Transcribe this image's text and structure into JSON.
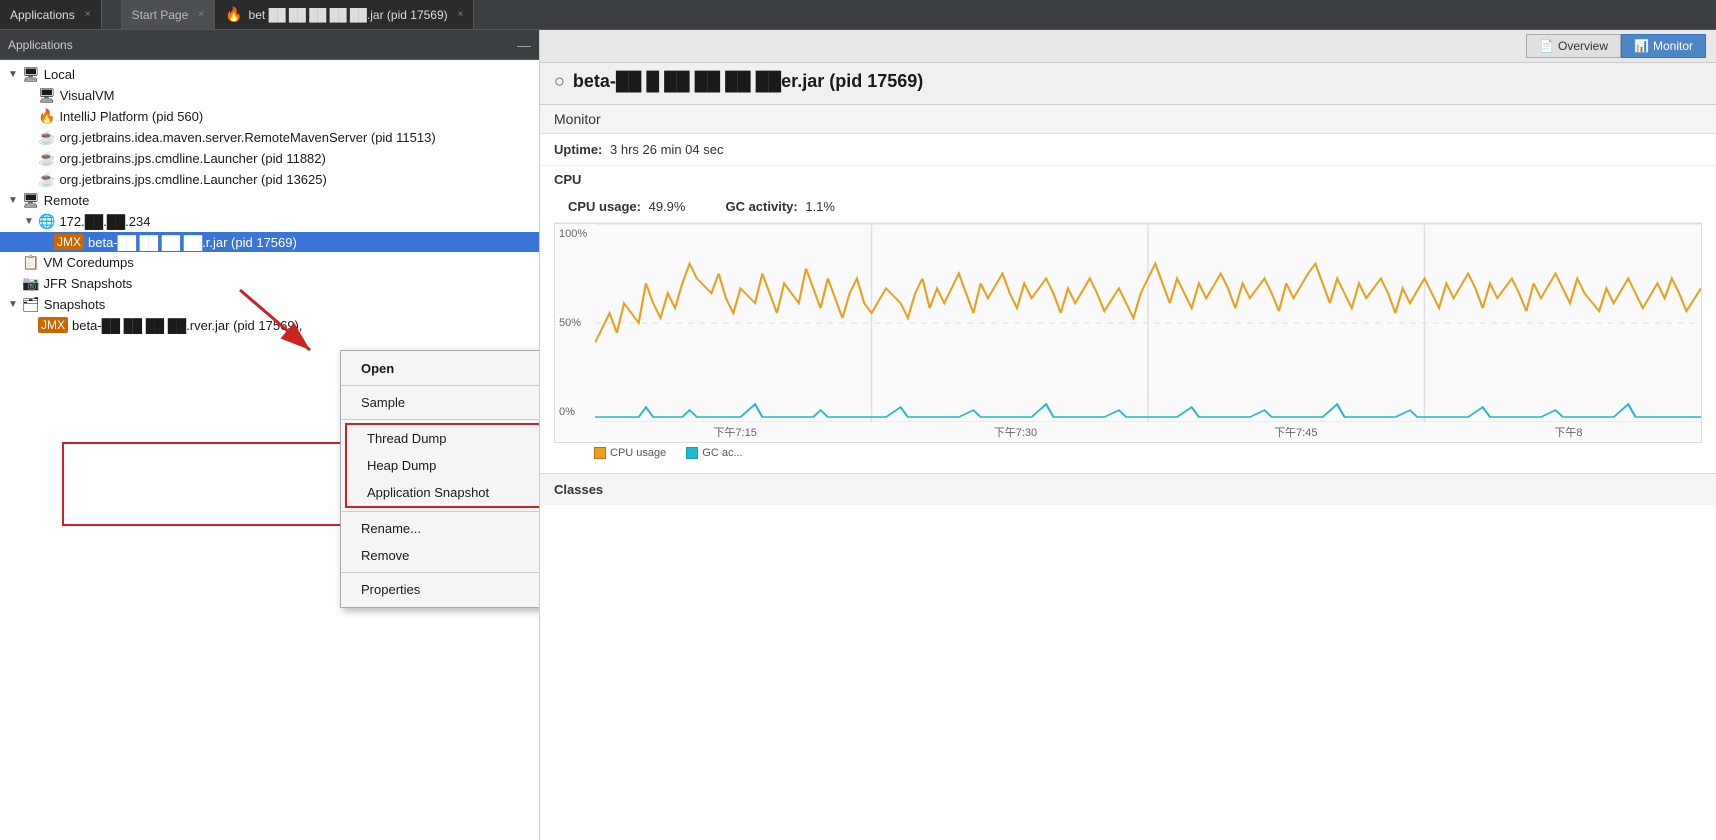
{
  "tabs": {
    "left": {
      "label": "Applications",
      "close": "×"
    },
    "right": [
      {
        "label": "Start Page",
        "close": "×",
        "active": false
      },
      {
        "label": "bet ██ ██ ██ ██ ██.jar (pid 17569)",
        "close": "×",
        "active": true
      }
    ]
  },
  "left_panel": {
    "title": "Applications",
    "minimize": "—",
    "tree": [
      {
        "level": 0,
        "arrow": "",
        "icon": "🖥",
        "label": "Local",
        "type": "folder-open"
      },
      {
        "level": 1,
        "arrow": "",
        "icon": "🖥",
        "label": "VisualVM",
        "type": "item"
      },
      {
        "level": 1,
        "arrow": "",
        "icon": "🔥",
        "label": "IntelliJ Platform (pid 560)",
        "type": "item"
      },
      {
        "level": 1,
        "arrow": "",
        "icon": "☕",
        "label": "org.jetbrains.idea.maven.server.RemoteMavenServer (pid 11513)",
        "type": "item"
      },
      {
        "level": 1,
        "arrow": "",
        "icon": "☕",
        "label": "org.jetbrains.jps.cmdline.Launcher (pid 11882)",
        "type": "item"
      },
      {
        "level": 1,
        "arrow": "",
        "icon": "☕",
        "label": "org.jetbrains.jps.cmdline.Launcher (pid 13625)",
        "type": "item"
      },
      {
        "level": 0,
        "arrow": "▼",
        "icon": "🖥",
        "label": "Remote",
        "type": "folder-open"
      },
      {
        "level": 1,
        "arrow": "▼",
        "icon": "🌐",
        "label": "172.██.██.234",
        "type": "folder-open"
      },
      {
        "level": 2,
        "arrow": "",
        "icon": "🔥",
        "label": "beta-██ ██ ██ ██.r.jar (pid 17569)",
        "type": "item",
        "selected": true
      },
      {
        "level": 0,
        "arrow": "",
        "icon": "📋",
        "label": "VM Coredumps",
        "type": "item"
      },
      {
        "level": 0,
        "arrow": "",
        "icon": "📷",
        "label": "JFR Snapshots",
        "type": "item"
      },
      {
        "level": 0,
        "arrow": "▼",
        "icon": "🗂",
        "label": "Snapshots",
        "type": "folder-open",
        "boxed": true
      },
      {
        "level": 1,
        "arrow": "",
        "icon": "☕",
        "label": "beta-██ ██ ██ ██.rver.jar (pid 17569),",
        "type": "item",
        "boxed": true
      }
    ]
  },
  "context_menu": {
    "items": [
      {
        "label": "Open",
        "bold": true,
        "group": false,
        "separator_after": false
      },
      {
        "label": "Sample",
        "bold": false,
        "group": false,
        "separator_after": true
      },
      {
        "label": "Thread Dump",
        "bold": false,
        "group": true,
        "separator_after": false
      },
      {
        "label": "Heap Dump",
        "bold": false,
        "group": true,
        "separator_after": false
      },
      {
        "label": "Application Snapshot",
        "bold": false,
        "group": true,
        "separator_after": true
      },
      {
        "label": "Rename...",
        "bold": false,
        "group": false,
        "separator_after": false
      },
      {
        "label": "Remove",
        "bold": false,
        "group": false,
        "separator_after": true
      },
      {
        "label": "Properties",
        "bold": false,
        "group": false,
        "separator_after": false
      }
    ]
  },
  "right_panel": {
    "app_title": "beta-██ █ ██ ██ ██ ██er.jar (pid 17569)",
    "spinner": "○",
    "buttons": [
      {
        "label": "Overview",
        "icon": "📄",
        "active": false
      },
      {
        "label": "Monitor",
        "icon": "📊",
        "active": true
      }
    ],
    "section": "Monitor",
    "uptime_label": "Uptime:",
    "uptime_value": "3 hrs 26 min 04 sec",
    "cpu_section": "CPU",
    "cpu_usage_label": "CPU usage:",
    "cpu_usage_value": "49.9%",
    "gc_activity_label": "GC activity:",
    "gc_activity_value": "1.1%",
    "chart": {
      "y_labels": [
        "100%",
        "50%",
        "0%"
      ],
      "x_labels": [
        "下午7:15",
        "下午7:30",
        "下午7:45",
        "下午8"
      ],
      "legend": [
        {
          "label": "CPU usage",
          "color": "#e8a020"
        },
        {
          "label": "GC ac...",
          "color": "#20a8c0"
        }
      ]
    },
    "classes_section": "Classes"
  }
}
